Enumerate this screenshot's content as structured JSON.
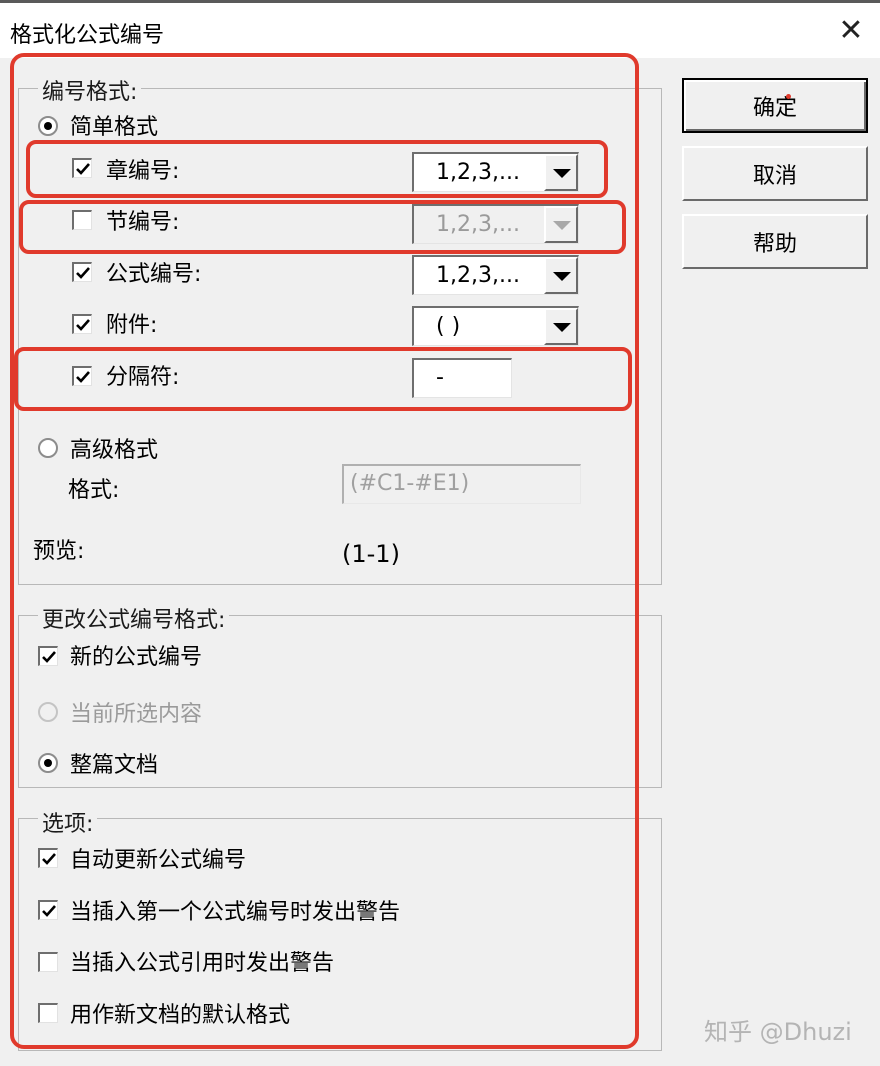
{
  "window": {
    "title": "格式化公式编号",
    "close_glyph": "✕"
  },
  "buttons": {
    "ok": "确定",
    "cancel": "取消",
    "help": "帮助"
  },
  "numbering_format": {
    "legend": "编号格式:",
    "simple_label": "简单格式",
    "simple_selected": true,
    "chapter": {
      "label": "章编号:",
      "checked": true,
      "value": "1,2,3,..."
    },
    "section": {
      "label": "节编号:",
      "checked": false,
      "value": "1,2,3,...",
      "disabled": true
    },
    "equation": {
      "label": "公式编号:",
      "checked": true,
      "value": "1,2,3,..."
    },
    "attachment": {
      "label": "附件:",
      "checked": true,
      "value": "( )"
    },
    "separator": {
      "label": "分隔符:",
      "checked": true,
      "value": "-"
    },
    "advanced_label": "高级格式",
    "advanced_selected": false,
    "format_label": "格式:",
    "format_value": "(#C1-#E1)",
    "preview_label": "预览:",
    "preview_value": "(1-1)"
  },
  "change_format": {
    "legend": "更改公式编号格式:",
    "new_numbers": {
      "label": "新的公式编号",
      "checked": true
    },
    "current_selection": {
      "label": "当前所选内容",
      "disabled": true
    },
    "whole_document": {
      "label": "整篇文档",
      "selected": true
    }
  },
  "options": {
    "legend": "选项:",
    "items": [
      {
        "label": "自动更新公式编号",
        "checked": true
      },
      {
        "label": "当插入第一个公式编号时发出警告",
        "checked": true
      },
      {
        "label": "当插入公式引用时发出警告",
        "checked": false
      },
      {
        "label": "用作新文档的默认格式",
        "checked": false
      }
    ]
  },
  "highlight_color": "#e03a2c",
  "watermark": "知乎 @Dhuzi"
}
